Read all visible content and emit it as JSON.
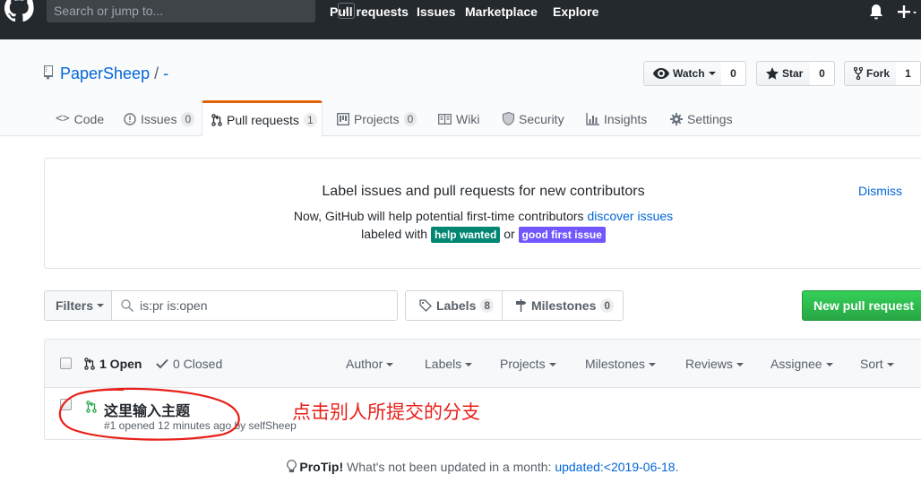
{
  "header": {
    "search_placeholder": "Search or jump to...",
    "search_shortcut": "/",
    "nav": [
      "Pull requests",
      "Issues",
      "Marketplace",
      "Explore"
    ],
    "plus_label": "+"
  },
  "repo": {
    "owner": "PaperSheep",
    "separator": "/",
    "name": "-",
    "watch_label": "Watch",
    "watch_count": "0",
    "star_label": "Star",
    "star_count": "0",
    "fork_label": "Fork",
    "fork_count": "1"
  },
  "tabs": [
    {
      "label": "Code",
      "icon": "code-icon"
    },
    {
      "label": "Issues",
      "count": "0",
      "icon": "issue-icon"
    },
    {
      "label": "Pull requests",
      "count": "1",
      "icon": "git-pull-request-icon"
    },
    {
      "label": "Projects",
      "count": "0",
      "icon": "project-icon"
    },
    {
      "label": "Wiki",
      "icon": "book-icon"
    },
    {
      "label": "Security",
      "icon": "shield-icon"
    },
    {
      "label": "Insights",
      "icon": "graph-icon"
    },
    {
      "label": "Settings",
      "icon": "gear-icon"
    }
  ],
  "banner": {
    "title": "Label issues and pull requests for new contributors",
    "line1_prefix": "Now, GitHub will help potential first-time contributors",
    "line1_link": "discover issues",
    "line2_prefix": "labeled with",
    "label_help": "help wanted",
    "line2_or": "or",
    "label_good": "good first issue",
    "dismiss": "Dismiss"
  },
  "filters": {
    "button": "Filters",
    "query": "is:pr is:open",
    "labels": "Labels",
    "labels_count": "8",
    "milestones": "Milestones",
    "milestones_count": "0",
    "new_pr": "New pull request"
  },
  "table": {
    "open": "1 Open",
    "closed": "0 Closed",
    "menus": [
      "Author",
      "Labels",
      "Projects",
      "Milestones",
      "Reviews",
      "Assignee",
      "Sort"
    ],
    "rows": [
      {
        "title": "这里输入主题",
        "meta": "#1 opened 12 minutes ago by selfSheep"
      }
    ]
  },
  "annotation": "点击别人所提交的分支",
  "protip": {
    "bold": "ProTip!",
    "text": "What's not been updated in a month:",
    "link": "updated:<2019-06-18",
    "end": "."
  },
  "colors": {
    "header_bg": "#24292e",
    "link": "#0366d6",
    "tab_active_border": "#e36209",
    "help_wanted": "#008672",
    "good_first_issue": "#7057ff",
    "new_pr_button": "#28a745",
    "open_pr_icon": "#28a745",
    "annotation_red": "#e8201a"
  }
}
